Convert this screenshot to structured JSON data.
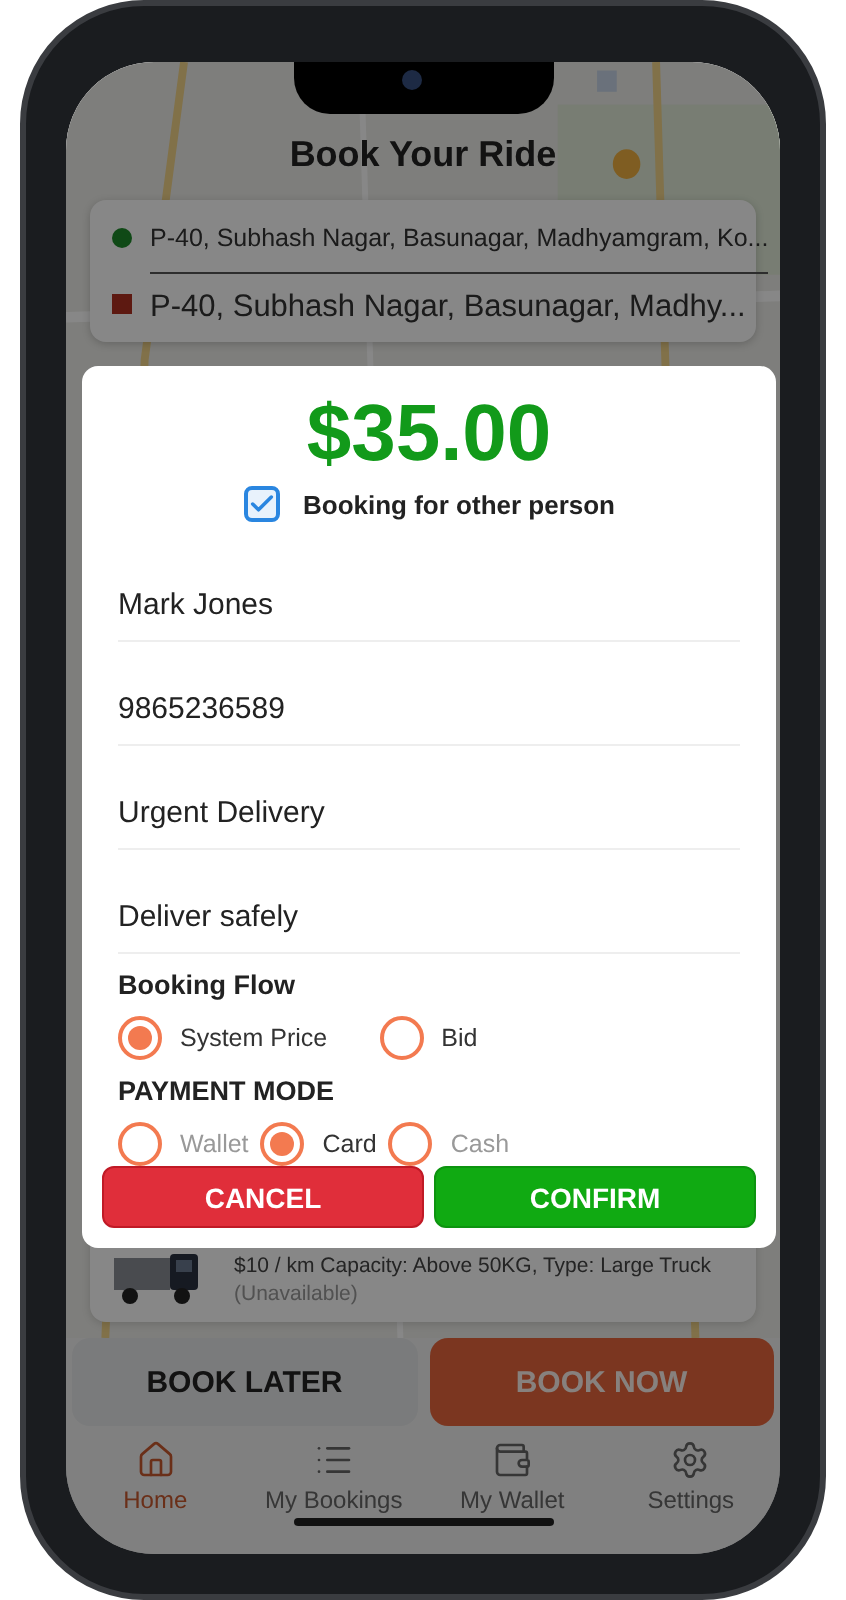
{
  "header": {
    "title": "Book Your Ride"
  },
  "route": {
    "pickup": "P-40, Subhash Nagar, Basunagar, Madhyamgram, Ko...",
    "drop": "P-40, Subhash Nagar, Basunagar, Madhy..."
  },
  "vehicle": {
    "details": "$10 / km  Capacity: Above 50KG, Type: Large Truck",
    "status": "(Unavailable)"
  },
  "actions": [
    {
      "kind": "secondary",
      "label": "BOOK LATER"
    },
    {
      "kind": "primary",
      "label": "BOOK NOW"
    }
  ],
  "tabs": [
    {
      "label": "Home",
      "selected": true
    },
    {
      "label": "My Bookings",
      "selected": false
    },
    {
      "label": "My Wallet",
      "selected": false
    },
    {
      "label": "Settings",
      "selected": false
    }
  ],
  "dialog": {
    "price": "$35.00",
    "other_person": {
      "label": "Booking for other person",
      "checked": true
    },
    "fields": [
      {
        "value": "Mark Jones"
      },
      {
        "value": "9865236589"
      },
      {
        "value": "Urgent Delivery"
      },
      {
        "value": "Deliver safely"
      }
    ],
    "booking_flow": {
      "title": "Booking Flow",
      "options": [
        {
          "label": "System Price",
          "selected": true,
          "disabled": false
        },
        {
          "label": "Bid",
          "selected": false,
          "disabled": false
        }
      ]
    },
    "payment_mode": {
      "title": "PAYMENT MODE",
      "options": [
        {
          "label": "Wallet",
          "selected": false,
          "disabled": true
        },
        {
          "label": "Card",
          "selected": true,
          "disabled": false
        },
        {
          "label": "Cash",
          "selected": false,
          "disabled": true
        }
      ]
    },
    "buttons": [
      {
        "kind": "cancel",
        "label": "CANCEL"
      },
      {
        "kind": "confirm",
        "label": "CONFIRM"
      }
    ]
  }
}
